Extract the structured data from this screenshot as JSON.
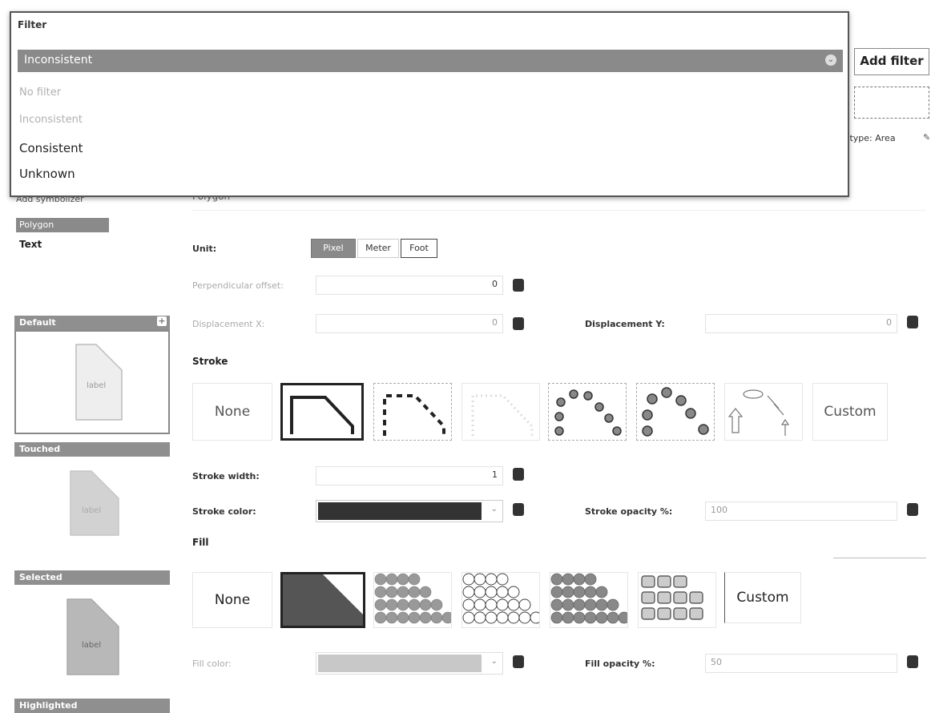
{
  "filter_dropdown": {
    "title": "Filter",
    "selected": "Inconsistent",
    "options": [
      {
        "label": "No filter",
        "dim": true
      },
      {
        "label": "Inconsistent",
        "dim": true
      },
      {
        "label": "Consistent",
        "dim": false
      },
      {
        "label": "Unknown",
        "dim": false
      }
    ]
  },
  "header": {
    "add_filter": "Add filter",
    "area_type_label": "g type: Area"
  },
  "sidebar": {
    "add_label": "Add symbolizer",
    "selected_item": "Polygon",
    "text_item": "Text",
    "states": [
      "Default",
      "Touched",
      "Selected",
      "Highlighted"
    ],
    "preview_label": "label"
  },
  "main": {
    "section_title": "Polygon",
    "unit_label": "Unit:",
    "unit_options": [
      "Pixel",
      "Meter",
      "Foot"
    ],
    "unit_selected": "Pixel",
    "perp_offset_label": "Perpendicular offset:",
    "perp_offset_value": "0",
    "disp_x_label": "Displacement X:",
    "disp_x_value": "0",
    "disp_y_label": "Displacement Y:",
    "disp_y_value": "0",
    "stroke_title": "Stroke",
    "stroke_none": "None",
    "stroke_custom": "Custom",
    "stroke_width_label": "Stroke width:",
    "stroke_width_value": "1",
    "stroke_color_label": "Stroke color:",
    "stroke_color": "#333333",
    "stroke_opacity_label": "Stroke opacity %:",
    "stroke_opacity_value": "100",
    "fill_title": "Fill",
    "fill_none": "None",
    "fill_custom": "Custom",
    "fill_color_label": "Fill color:",
    "fill_color": "#c8c8c8",
    "fill_opacity_label": "Fill opacity %:",
    "fill_opacity_value": "50"
  },
  "colors": {
    "selected_bar": "#8a8a8a",
    "dark": "#333333"
  }
}
